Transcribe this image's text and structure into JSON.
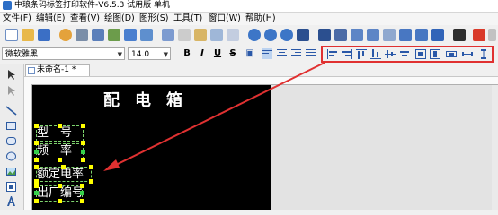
{
  "window": {
    "title": "中琅条码标签打印软件-V6.5.3 试用版 单机"
  },
  "menu": [
    "文件(F)",
    "编辑(E)",
    "查看(V)",
    "绘图(D)",
    "图形(S)",
    "工具(T)",
    "窗口(W)",
    "帮助(H)"
  ],
  "format_bar": {
    "font_name": "微软雅黑",
    "font_size": "14.0",
    "bold_label": "B",
    "italic_label": "I",
    "underline_label": "U",
    "strike_label": "S"
  },
  "document": {
    "tab_label": "未命名-1 *"
  },
  "label": {
    "heading": "配电箱",
    "fields": [
      "型　号",
      "频　率",
      "额定电率",
      "出厂编号"
    ]
  },
  "colors": {
    "highlight_box": "#e03131",
    "canvas": "#000000",
    "handle": "#ffff00",
    "text": "#ffffff"
  }
}
